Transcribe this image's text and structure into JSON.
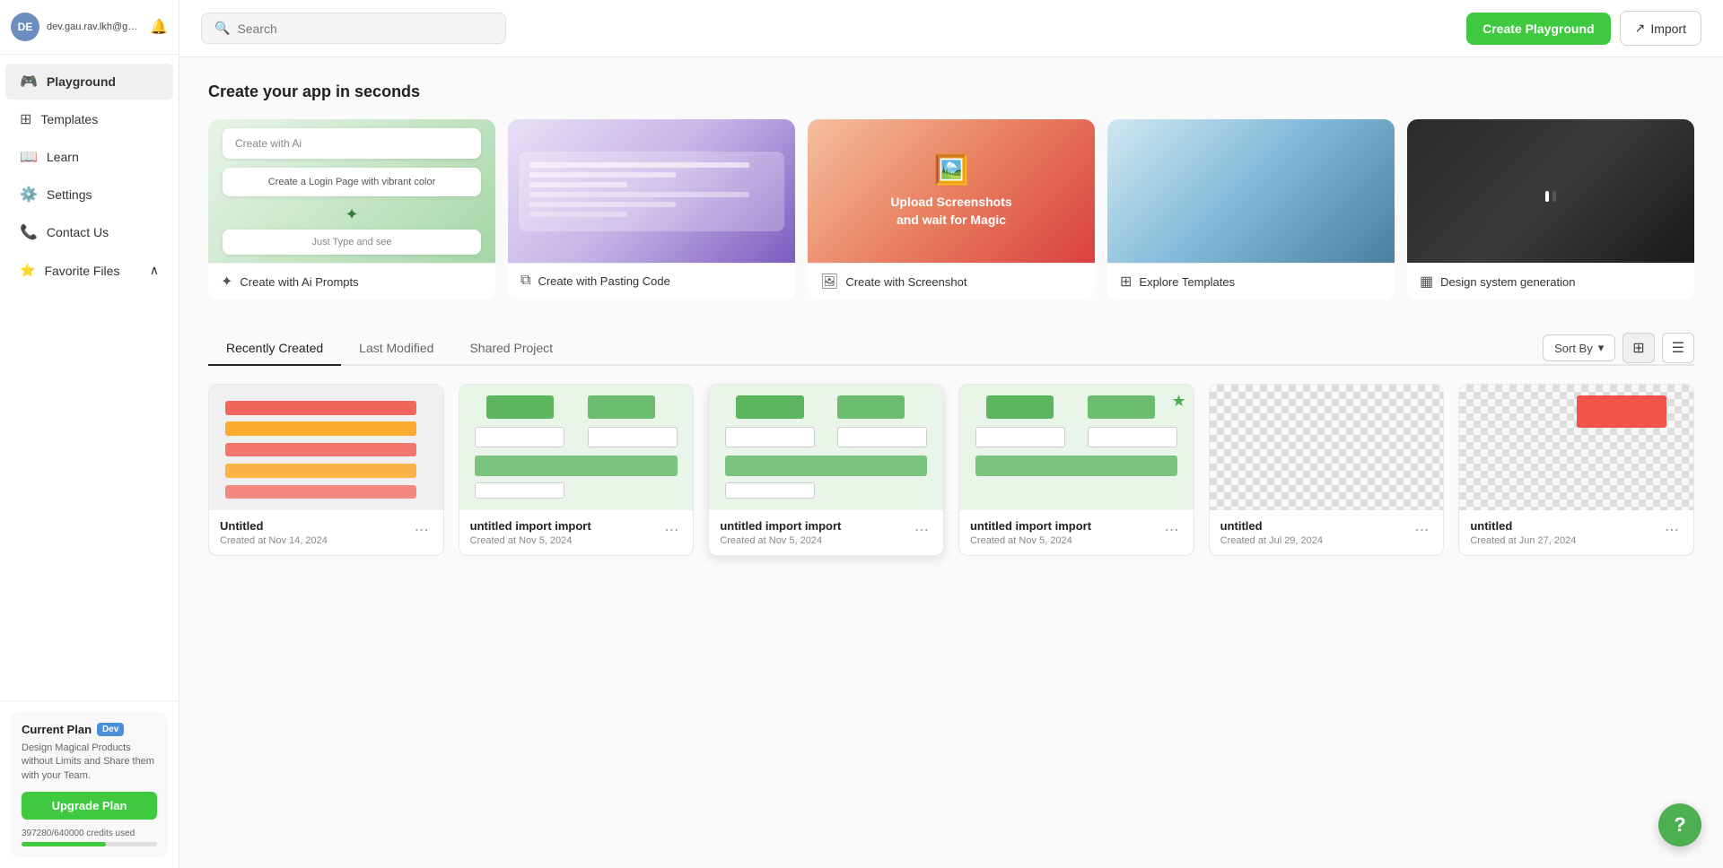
{
  "sidebar": {
    "user": {
      "email": "dev.gau.rav.lkh@gmail.com",
      "avatar_initials": "DE"
    },
    "nav_items": [
      {
        "id": "playground",
        "label": "Playground",
        "icon": "🎮",
        "active": true
      },
      {
        "id": "templates",
        "label": "Templates",
        "icon": "⊞"
      },
      {
        "id": "learn",
        "label": "Learn",
        "icon": "📖"
      },
      {
        "id": "settings",
        "label": "Settings",
        "icon": "⚙️"
      },
      {
        "id": "contact",
        "label": "Contact Us",
        "icon": "📞"
      }
    ],
    "favorites": {
      "label": "Favorite Files",
      "expanded": true
    },
    "plan": {
      "title": "Current Plan",
      "badge": "Dev",
      "description": "Design Magical Products without Limits and Share them with your Team.",
      "upgrade_label": "Upgrade Plan",
      "credits_used": "397280/640000 credits used",
      "credits_percent": "62.08",
      "credits_percent_num": 62.08
    }
  },
  "header": {
    "search_placeholder": "Search",
    "create_playground_label": "Create Playground",
    "import_label": "Import"
  },
  "main": {
    "hero_title": "Create your app in seconds",
    "creation_cards": [
      {
        "id": "ai-prompts",
        "label": "Create with Ai Prompts",
        "icon": "✦",
        "style": "ai",
        "preview_prompt_1": "Create with Ai",
        "preview_prompt_2": "Create a Login Page with vibrant color",
        "preview_just_type": "Just Type and see"
      },
      {
        "id": "paste-code",
        "label": "Create with Pasting Code",
        "icon": "⧉",
        "style": "paste"
      },
      {
        "id": "screenshot",
        "label": "Create with Screenshot",
        "icon": "🖼",
        "style": "screenshot",
        "preview_text_1": "Upload Screenshots",
        "preview_text_2": "and wait for Magic"
      },
      {
        "id": "templates",
        "label": "Explore Templates",
        "icon": "⊞",
        "style": "templates"
      },
      {
        "id": "design-system",
        "label": "Design system generation",
        "icon": "▦",
        "style": "design"
      }
    ],
    "tabs": [
      {
        "id": "recently-created",
        "label": "Recently Created",
        "active": true
      },
      {
        "id": "last-modified",
        "label": "Last Modified"
      },
      {
        "id": "shared-project",
        "label": "Shared Project"
      }
    ],
    "sort_label": "Sort By",
    "projects": [
      {
        "id": 1,
        "name": "Untitled",
        "date": "Created at Nov 14, 2024",
        "has_content": true,
        "starred": false
      },
      {
        "id": 2,
        "name": "untitled import import",
        "date": "Created at Nov 5, 2024",
        "has_content": true,
        "starred": false
      },
      {
        "id": 3,
        "name": "untitled import import",
        "date": "Created at Nov 5, 2024",
        "has_content": true,
        "starred": false,
        "hovered": true
      },
      {
        "id": 4,
        "name": "untitled import import",
        "date": "Created at Nov 5, 2024",
        "has_content": true,
        "starred": true
      },
      {
        "id": 5,
        "name": "untitled",
        "date": "Created at Jul 29, 2024",
        "has_content": false,
        "starred": false
      },
      {
        "id": 6,
        "name": "untitled",
        "date": "Created at Jun 27, 2024",
        "has_content": false,
        "starred": false
      }
    ]
  },
  "help": {
    "icon": "?"
  }
}
